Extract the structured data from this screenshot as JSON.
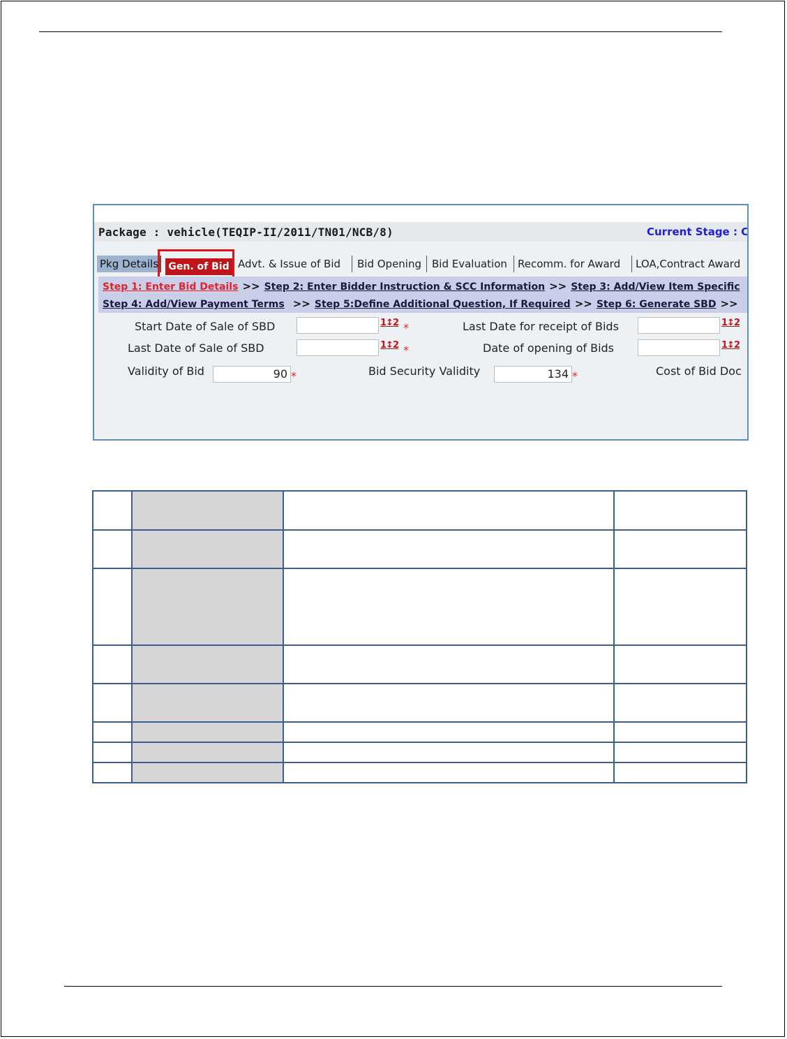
{
  "package": {
    "title": "Package : vehicle(TEQIP-II/2011/TN01/NCB/8)",
    "current_stage": "Current Stage : C"
  },
  "tabs": [
    {
      "label": "Pkg Details"
    },
    {
      "label": "Gen. of Bid"
    },
    {
      "label": "Advt. & Issue of Bid"
    },
    {
      "label": "Bid Opening"
    },
    {
      "label": "Bid Evaluation"
    },
    {
      "label": "Recomm. for Award"
    },
    {
      "label": "LOA,Contract Award"
    }
  ],
  "steps": {
    "arrow": ">>",
    "row1": [
      "Step 1: Enter Bid Details",
      "Step 2: Enter Bidder Instruction & SCC Information",
      "Step 3: Add/View Item Specific"
    ],
    "row2": [
      "Step 4: Add/View Payment Terms",
      "Step 5:Define Additional Question, If Required",
      "Step 6: Generate SBD"
    ]
  },
  "form": {
    "start_sale_label": "Start Date of Sale of SBD",
    "last_sale_label": "Last Date of Sale of SBD",
    "last_receipt_label": "Last Date for receipt of Bids",
    "opening_label": "Date of opening of Bids",
    "validity_label": "Validity of Bid",
    "validity_value": "90",
    "security_label": "Bid Security Validity",
    "security_value": "134",
    "cost_label": "Cost of Bid Doc",
    "calendar_glyph": "1↕2",
    "required_mark": "*"
  }
}
